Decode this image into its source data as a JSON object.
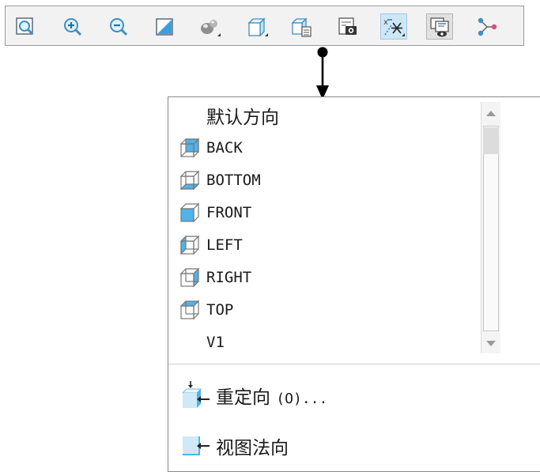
{
  "toolbar": {
    "buttons": [
      {
        "icon": "refit-icon"
      },
      {
        "icon": "zoom-in-icon"
      },
      {
        "icon": "zoom-out-icon"
      },
      {
        "icon": "repaint-icon"
      },
      {
        "icon": "display-style-icon"
      },
      {
        "icon": "named-views-icon"
      },
      {
        "icon": "saved-orientations-icon"
      },
      {
        "icon": "view-manager-icon"
      },
      {
        "icon": "datum-display-icon",
        "state": "active"
      },
      {
        "icon": "annotation-display-icon",
        "state": "pressed"
      },
      {
        "icon": "spin-center-icon"
      }
    ]
  },
  "views": {
    "items": [
      {
        "label": "默认方向",
        "icon": ""
      },
      {
        "label": "BACK",
        "icon": "cube-back-icon"
      },
      {
        "label": "BOTTOM",
        "icon": "cube-bottom-icon"
      },
      {
        "label": "FRONT",
        "icon": "cube-front-icon"
      },
      {
        "label": "LEFT",
        "icon": "cube-left-icon"
      },
      {
        "label": "RIGHT",
        "icon": "cube-right-icon"
      },
      {
        "label": "TOP",
        "icon": "cube-top-icon"
      },
      {
        "label": "V1",
        "icon": ""
      }
    ]
  },
  "actions": {
    "reorient_label": "重定向",
    "reorient_suffix": "(O)...",
    "normal_label": "视图法向"
  },
  "colors": {
    "accent": "#4fb4e8",
    "active_bg": "#cde7f6"
  }
}
